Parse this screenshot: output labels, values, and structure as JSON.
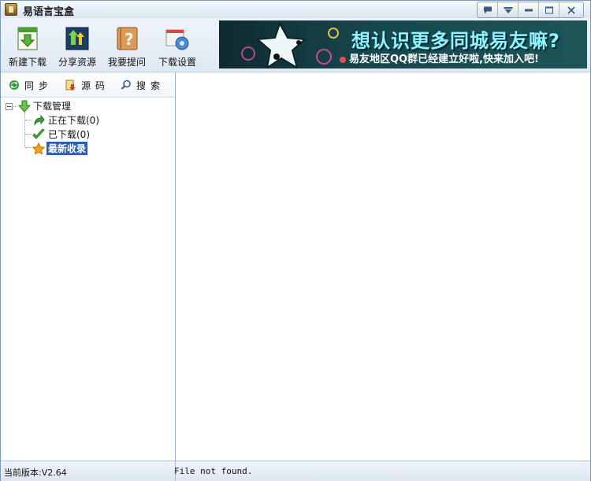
{
  "window": {
    "title": "易语言宝盒"
  },
  "toolbar": {
    "buttons": [
      {
        "label": "新建下载",
        "icon": "new-download-icon"
      },
      {
        "label": "分享资源",
        "icon": "share-upload-icon"
      },
      {
        "label": "我要提问",
        "icon": "question-book-icon"
      },
      {
        "label": "下载设置",
        "icon": "settings-gear-icon"
      }
    ]
  },
  "banner": {
    "headline": "想认识更多同城易友嘛?",
    "subline": "易友地区QQ群已经建立好啦,快来加入吧!"
  },
  "tabs": {
    "sync": "同步",
    "source": "源码",
    "search": "搜索"
  },
  "tree": {
    "root": "下载管理",
    "downloading": "正在下载(0)",
    "downloaded": "已下载(0)",
    "latest": "最新收录"
  },
  "status": {
    "version": "当前版本:V2.64",
    "message": "File not found."
  },
  "colors": {
    "accent": "#2f5fa8",
    "banner_text": "#8ff4ff",
    "border": "#7c9ab8"
  }
}
